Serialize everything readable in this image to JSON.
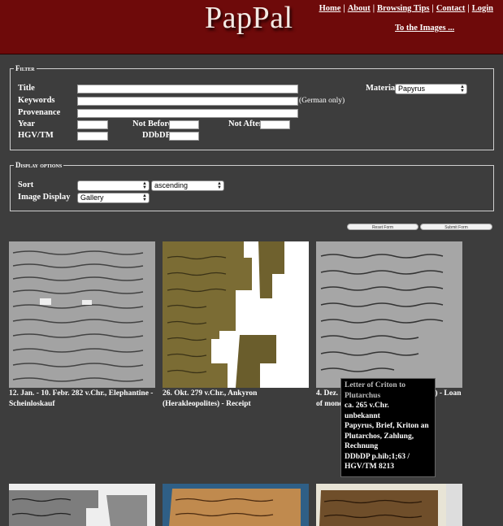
{
  "header": {
    "logo": "PapPal",
    "nav": [
      "Home",
      "About",
      "Browsing Tips",
      "Contact",
      "Login"
    ],
    "to_images": "To the Images ..."
  },
  "filter": {
    "legend": "Filter",
    "title_label": "Title",
    "keywords_label": "Keywords",
    "keywords_note": "(German only)",
    "provenance_label": "Provenance",
    "year_label": "Year",
    "not_before_label": "Not Before",
    "not_after_label": "Not After",
    "hgv_label": "HGV/TM",
    "ddbdp_label": "DDbDP",
    "material_label": "Material",
    "material_value": "Papyrus"
  },
  "display": {
    "legend": "Display options",
    "sort_label": "Sort",
    "sort_value": "",
    "order_value": "ascending",
    "image_display_label": "Image Display",
    "image_display_value": "Gallery"
  },
  "buttons": {
    "reset": "Reset Form",
    "submit": "Submit Form"
  },
  "gallery": [
    {
      "caption": "12. Jan. - 10. Febr. 282 v.Chr., Elephantine - Scheinloskauf"
    },
    {
      "caption": "26. Okt. 279 v.Chr., Ankyron (Herakleopolites) - Receipt"
    },
    {
      "caption": "4. Dez. 273 v.Chr., Pitos (Memphites) - Loan of money"
    }
  ],
  "tooltip": {
    "title": "Letter of Criton to Plutarchus",
    "date": "ca. 265 v.Chr.",
    "place": "unbekannt",
    "keywords": "Papyrus, Brief, Kriton an Plutarchos, Zahlung, Rechnung",
    "ids": "DDbDP p.hib;1;63 / HGV/TM 8213"
  }
}
